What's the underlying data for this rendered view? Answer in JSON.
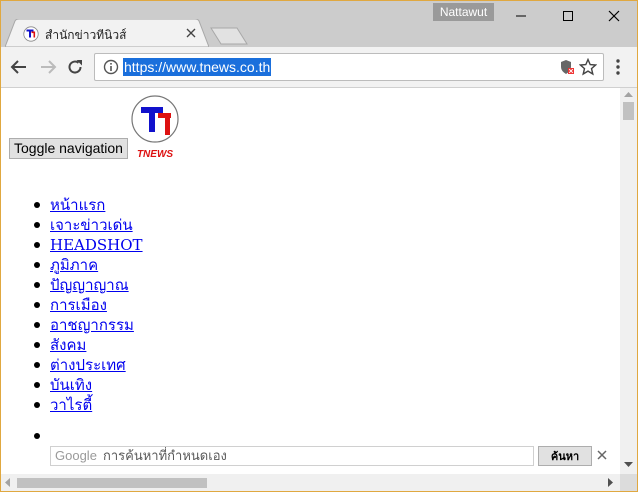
{
  "window": {
    "user_name": "Nattawut"
  },
  "tab": {
    "title": "สำนักข่าวทีนิวส์"
  },
  "toolbar": {
    "url": "https://www.tnews.co.th"
  },
  "page": {
    "toggle_label": "Toggle navigation",
    "logo_text": "TNEWS",
    "nav_items": [
      {
        "label": "หน้าแรก"
      },
      {
        "label": "เจาะข่าวเด่น"
      },
      {
        "label": "HEADSHOT"
      },
      {
        "label": "ภูมิภาค"
      },
      {
        "label": "ปัญญาญาณ"
      },
      {
        "label": "การเมือง"
      },
      {
        "label": "อาชญากรรม"
      },
      {
        "label": "สังคม"
      },
      {
        "label": "ต่างประเทศ"
      },
      {
        "label": "บันเทิง"
      },
      {
        "label": "วาไรตี้"
      }
    ],
    "search": {
      "brand": "Google",
      "placeholder": "การค้นหาที่กำหนดเอง",
      "button_label": "ค้นหา"
    }
  },
  "colors": {
    "url_highlight": "#1a6fdc",
    "link": "#0000ee",
    "logo_blue": "#1111cc",
    "logo_red": "#dd1111",
    "window_border": "#e0a840"
  }
}
